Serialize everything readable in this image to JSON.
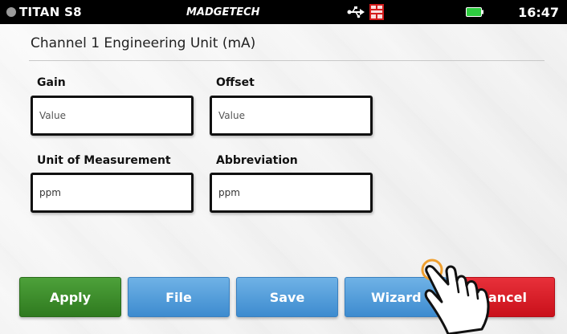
{
  "status_bar": {
    "device_name": "TITAN S8",
    "brand": "MADGETECH",
    "time": "16:47",
    "icons": [
      "usb-icon",
      "data-logger-icon",
      "battery-icon"
    ]
  },
  "page": {
    "title": "Channel 1 Engineering Unit (mA)"
  },
  "fields": {
    "gain": {
      "label": "Gain",
      "value": "",
      "placeholder": "Value"
    },
    "offset": {
      "label": "Offset",
      "value": "",
      "placeholder": "Value"
    },
    "unit": {
      "label": "Unit of Measurement",
      "value": "ppm"
    },
    "abbreviation": {
      "label": "Abbreviation",
      "value": "ppm"
    }
  },
  "buttons": {
    "apply": "Apply",
    "file": "File",
    "save": "Save",
    "wizard": "Wizard",
    "cancel": "Cancel"
  },
  "colors": {
    "apply": "#3a8c2a",
    "file": "#4f9ad9",
    "save": "#4f9ad9",
    "wizard": "#4f9ad9",
    "cancel": "#d91c24",
    "battery": "#2ecc40",
    "logger_icon": "#e02020"
  }
}
